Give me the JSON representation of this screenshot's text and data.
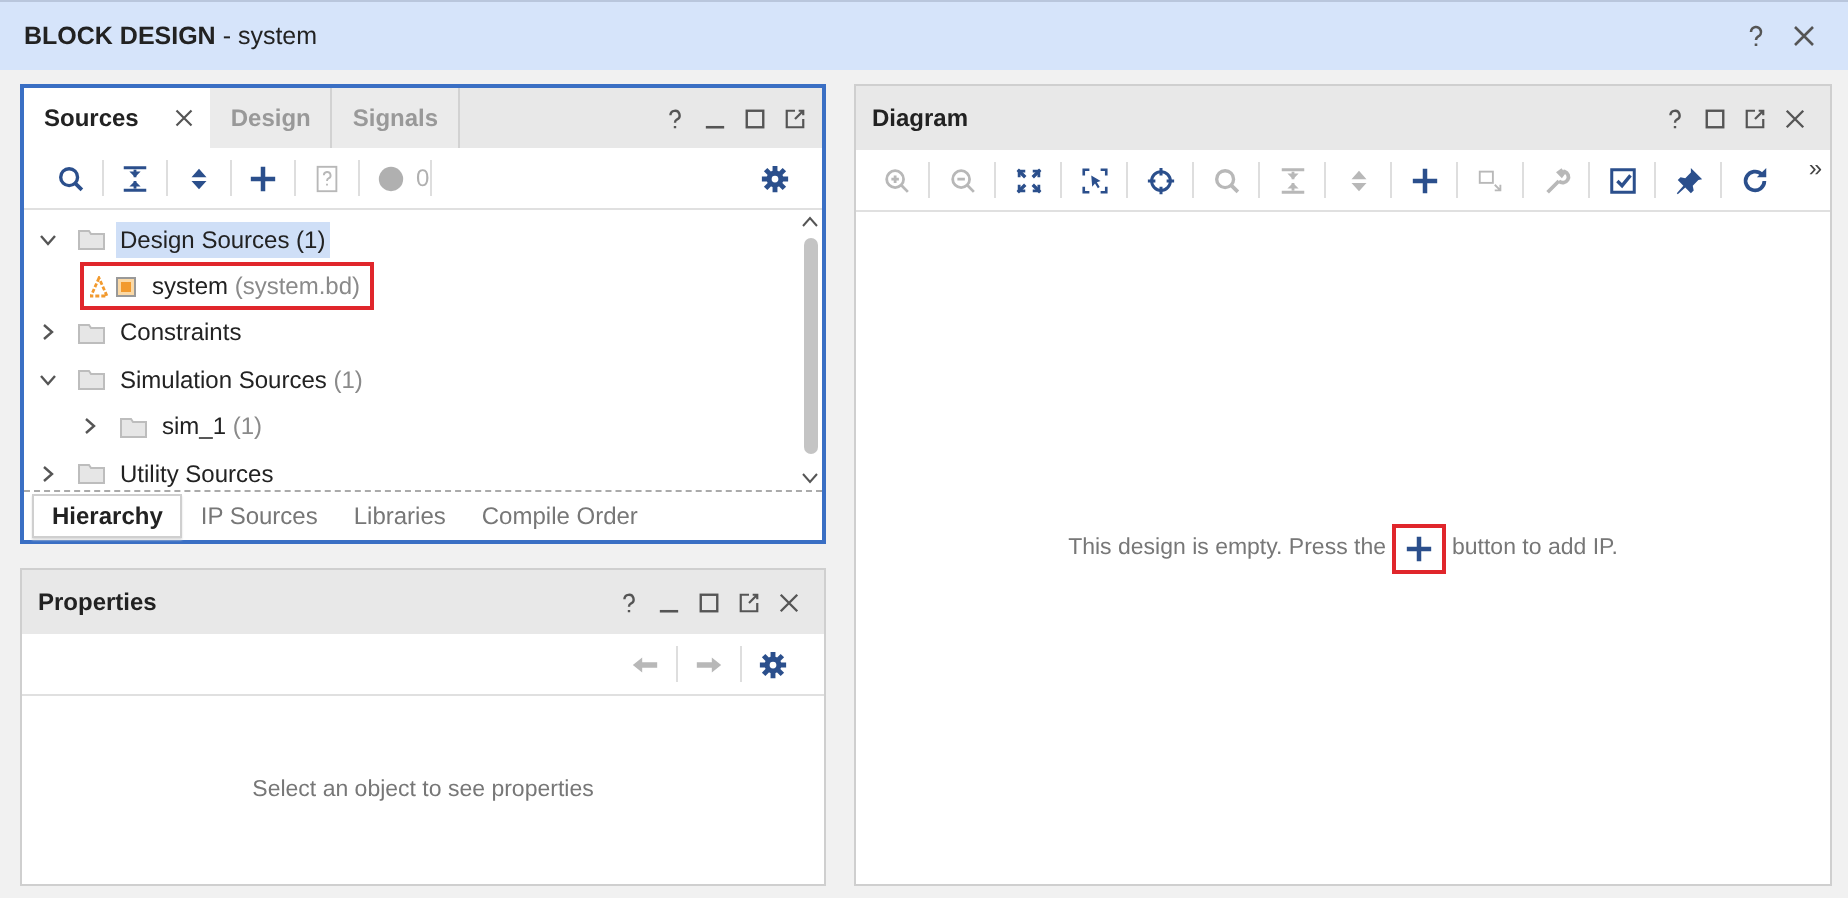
{
  "window": {
    "title": "BLOCK DESIGN",
    "subtitle": "- system"
  },
  "sources": {
    "focused": true,
    "tabs": [
      {
        "label": "Sources",
        "selected": true
      },
      {
        "label": "Design",
        "selected": false
      },
      {
        "label": "Signals",
        "selected": false
      }
    ],
    "toolbar": [
      {
        "kind": "search",
        "disabled": false
      },
      {
        "kind": "collapse",
        "disabled": false
      },
      {
        "kind": "expand",
        "disabled": false
      },
      {
        "kind": "add",
        "disabled": false
      },
      {
        "kind": "help-doc",
        "disabled": true
      },
      {
        "kind": "status",
        "disabled": true,
        "count": "0"
      },
      {
        "kind": "gear",
        "disabled": false
      }
    ],
    "tree": [
      {
        "kind": "folder",
        "label": "Design Sources (1)",
        "expanded": true,
        "selected": true,
        "children": [
          {
            "kind": "block-design",
            "label": "system",
            "detail": "(system.bd)",
            "selected": false,
            "marked": true
          }
        ]
      },
      {
        "kind": "folder",
        "label": "Constraints",
        "expanded": false,
        "selected": false
      },
      {
        "kind": "folder",
        "label": "Simulation Sources",
        "detail": "(1)",
        "expanded": true,
        "selected": false,
        "children": [
          {
            "kind": "folder",
            "label": "sim_1",
            "detail": "(1)",
            "expanded": false,
            "selected": false
          }
        ]
      },
      {
        "kind": "folder",
        "label": "Utility Sources",
        "expanded": false,
        "selected": false
      }
    ],
    "bottom_tabs": [
      {
        "label": "Hierarchy",
        "selected": true
      },
      {
        "label": "IP Sources",
        "selected": false
      },
      {
        "label": "Libraries",
        "selected": false
      },
      {
        "label": "Compile Order",
        "selected": false
      }
    ]
  },
  "properties": {
    "title": "Properties",
    "toolbar": [
      {
        "kind": "back",
        "disabled": true
      },
      {
        "kind": "forward",
        "disabled": true
      },
      {
        "kind": "gear",
        "disabled": false
      }
    ],
    "message": "Select an object to see properties"
  },
  "diagram": {
    "title": "Diagram",
    "toolbar": [
      {
        "kind": "zoom-in",
        "disabled": true
      },
      {
        "kind": "zoom-out",
        "disabled": true
      },
      {
        "kind": "fit",
        "disabled": false
      },
      {
        "kind": "select-area",
        "disabled": false
      },
      {
        "kind": "crosshair",
        "disabled": false
      },
      {
        "kind": "search",
        "disabled": true
      },
      {
        "kind": "collapse",
        "disabled": true
      },
      {
        "kind": "expand",
        "disabled": true
      },
      {
        "kind": "add",
        "disabled": false
      },
      {
        "kind": "port",
        "disabled": true
      },
      {
        "kind": "wrench",
        "disabled": true
      },
      {
        "kind": "validate",
        "disabled": false
      },
      {
        "kind": "pin",
        "disabled": false
      },
      {
        "kind": "refresh",
        "disabled": false
      }
    ],
    "overflow": "»",
    "message_before": "This design is empty. Press the",
    "message_button": {
      "marked": true
    },
    "message_after": "button to add IP."
  }
}
